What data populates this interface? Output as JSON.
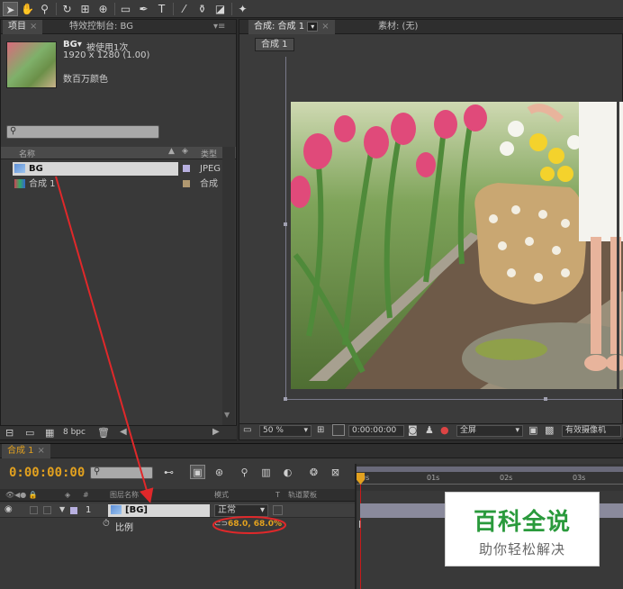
{
  "toolbar": {
    "tools": [
      {
        "icon": "selection-arrow-icon",
        "glyph": "➤"
      },
      {
        "icon": "hand-icon",
        "glyph": "✋"
      },
      {
        "icon": "zoom-icon",
        "glyph": "⚲"
      },
      {
        "icon": "rotate-icon",
        "glyph": "↻"
      },
      {
        "icon": "camera-orbit-icon",
        "glyph": "⊞"
      },
      {
        "icon": "pan-behind-icon",
        "glyph": "⊕"
      },
      {
        "icon": "rectangle-mask-icon",
        "glyph": "▭"
      },
      {
        "icon": "pen-icon",
        "glyph": "✒"
      },
      {
        "icon": "type-icon",
        "glyph": "T"
      },
      {
        "icon": "brush-icon",
        "glyph": "⁄"
      },
      {
        "icon": "clone-stamp-icon",
        "glyph": "⚱"
      },
      {
        "icon": "eraser-icon",
        "glyph": "◪"
      },
      {
        "icon": "puppet-pin-icon",
        "glyph": "✦"
      }
    ]
  },
  "project_panel": {
    "tab_project": "项目",
    "tab_effects": "特效控制台: BG",
    "item_name": "BG▾",
    "item_usage": "被使用1次",
    "item_dims": "1920 x 1280 (1.00)",
    "item_colors": "数百万颜色",
    "col_name": "名称",
    "col_type": "类型",
    "rows": [
      {
        "name": "BG",
        "type": "JPEG",
        "label_color": "#b8b0e0"
      },
      {
        "name": "合成 1",
        "type": "合成",
        "label_color": "#b09870"
      }
    ],
    "bpc": "8 bpc"
  },
  "viewer": {
    "tab_comp": "合成: 合成 1",
    "tab_footage": "素材: (无)",
    "comp_button": "合成 1",
    "zoom": "50 %",
    "timecode": "0:00:00:00",
    "resolution": "全屏",
    "camera": "有效摄像机"
  },
  "timeline": {
    "tab": "合成 1",
    "current_time": "0:00:00:00",
    "col_layer_name": "图层名称",
    "col_mode": "模式",
    "col_t": "T",
    "col_trkmat": "轨道蒙板",
    "ruler_labels": [
      "0s",
      "01s",
      "02s",
      "03s"
    ],
    "layer": {
      "index": "1",
      "name": "[BG]",
      "mode": "正常"
    },
    "property": {
      "name": "比例",
      "value": "68.0, 68.0%"
    }
  },
  "watermark": {
    "title": "百科全说",
    "subtitle": "助你轻松解决"
  },
  "colors": {
    "accent_orange": "#e2a11f",
    "annotation_red": "#e0282a",
    "watermark_green": "#2a9a3c"
  }
}
